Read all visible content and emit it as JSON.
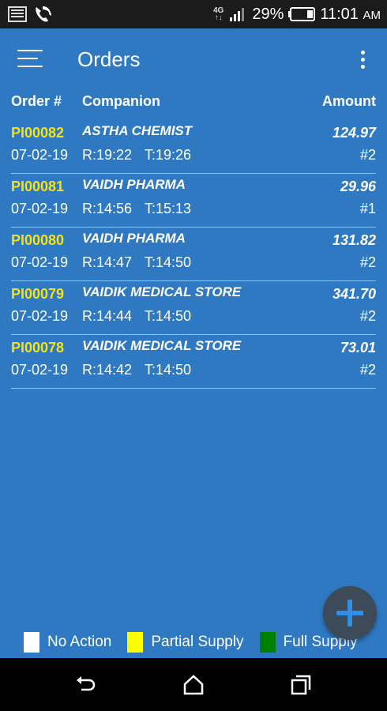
{
  "status_bar": {
    "network": "4G",
    "battery_percent": "29%",
    "time": "11:01",
    "time_suffix": "AM",
    "icons": [
      "screenshot-icon",
      "call-icon",
      "signal-icon",
      "battery-icon"
    ]
  },
  "app_bar": {
    "title": "Orders",
    "icons": [
      "menu-icon",
      "more-vert-icon"
    ]
  },
  "table": {
    "headers": {
      "order": "Order #",
      "companion": "Companion",
      "amount": "Amount"
    },
    "rows": [
      {
        "order_id": "PI00082",
        "companion": "ASTHA CHEMIST",
        "amount": "124.97",
        "date": "07-02-19",
        "r_time": "R:19:22",
        "t_time": "T:19:26",
        "count": "#2"
      },
      {
        "order_id": "PI00081",
        "companion": "VAIDH PHARMA",
        "amount": "29.96",
        "date": "07-02-19",
        "r_time": "R:14:56",
        "t_time": "T:15:13",
        "count": "#1"
      },
      {
        "order_id": "PI00080",
        "companion": "VAIDH PHARMA",
        "amount": "131.82",
        "date": "07-02-19",
        "r_time": "R:14:47",
        "t_time": "T:14:50",
        "count": "#2"
      },
      {
        "order_id": "PI00079",
        "companion": "VAIDIK MEDICAL STORE",
        "amount": "341.70",
        "date": "07-02-19",
        "r_time": "R:14:44",
        "t_time": "T:14:50",
        "count": "#2"
      },
      {
        "order_id": "PI00078",
        "companion": "VAIDIK MEDICAL STORE",
        "amount": "73.01",
        "date": "07-02-19",
        "r_time": "R:14:42",
        "t_time": "T:14:50",
        "count": "#2"
      }
    ]
  },
  "fab": {
    "icon": "add-icon"
  },
  "legend": [
    {
      "label": "No Action",
      "color": "#ffffff"
    },
    {
      "label": "Partial Supply",
      "color": "#ffff00"
    },
    {
      "label": "Full Supply",
      "color": "#008000"
    }
  ],
  "colors": {
    "background": "#2f79c2",
    "order_id": "#f2e11b",
    "fab": "#3d4a57",
    "fab_plus": "#2f8fe6"
  },
  "nav_bar": {
    "icons": [
      "back-icon",
      "home-icon",
      "recents-icon"
    ]
  }
}
